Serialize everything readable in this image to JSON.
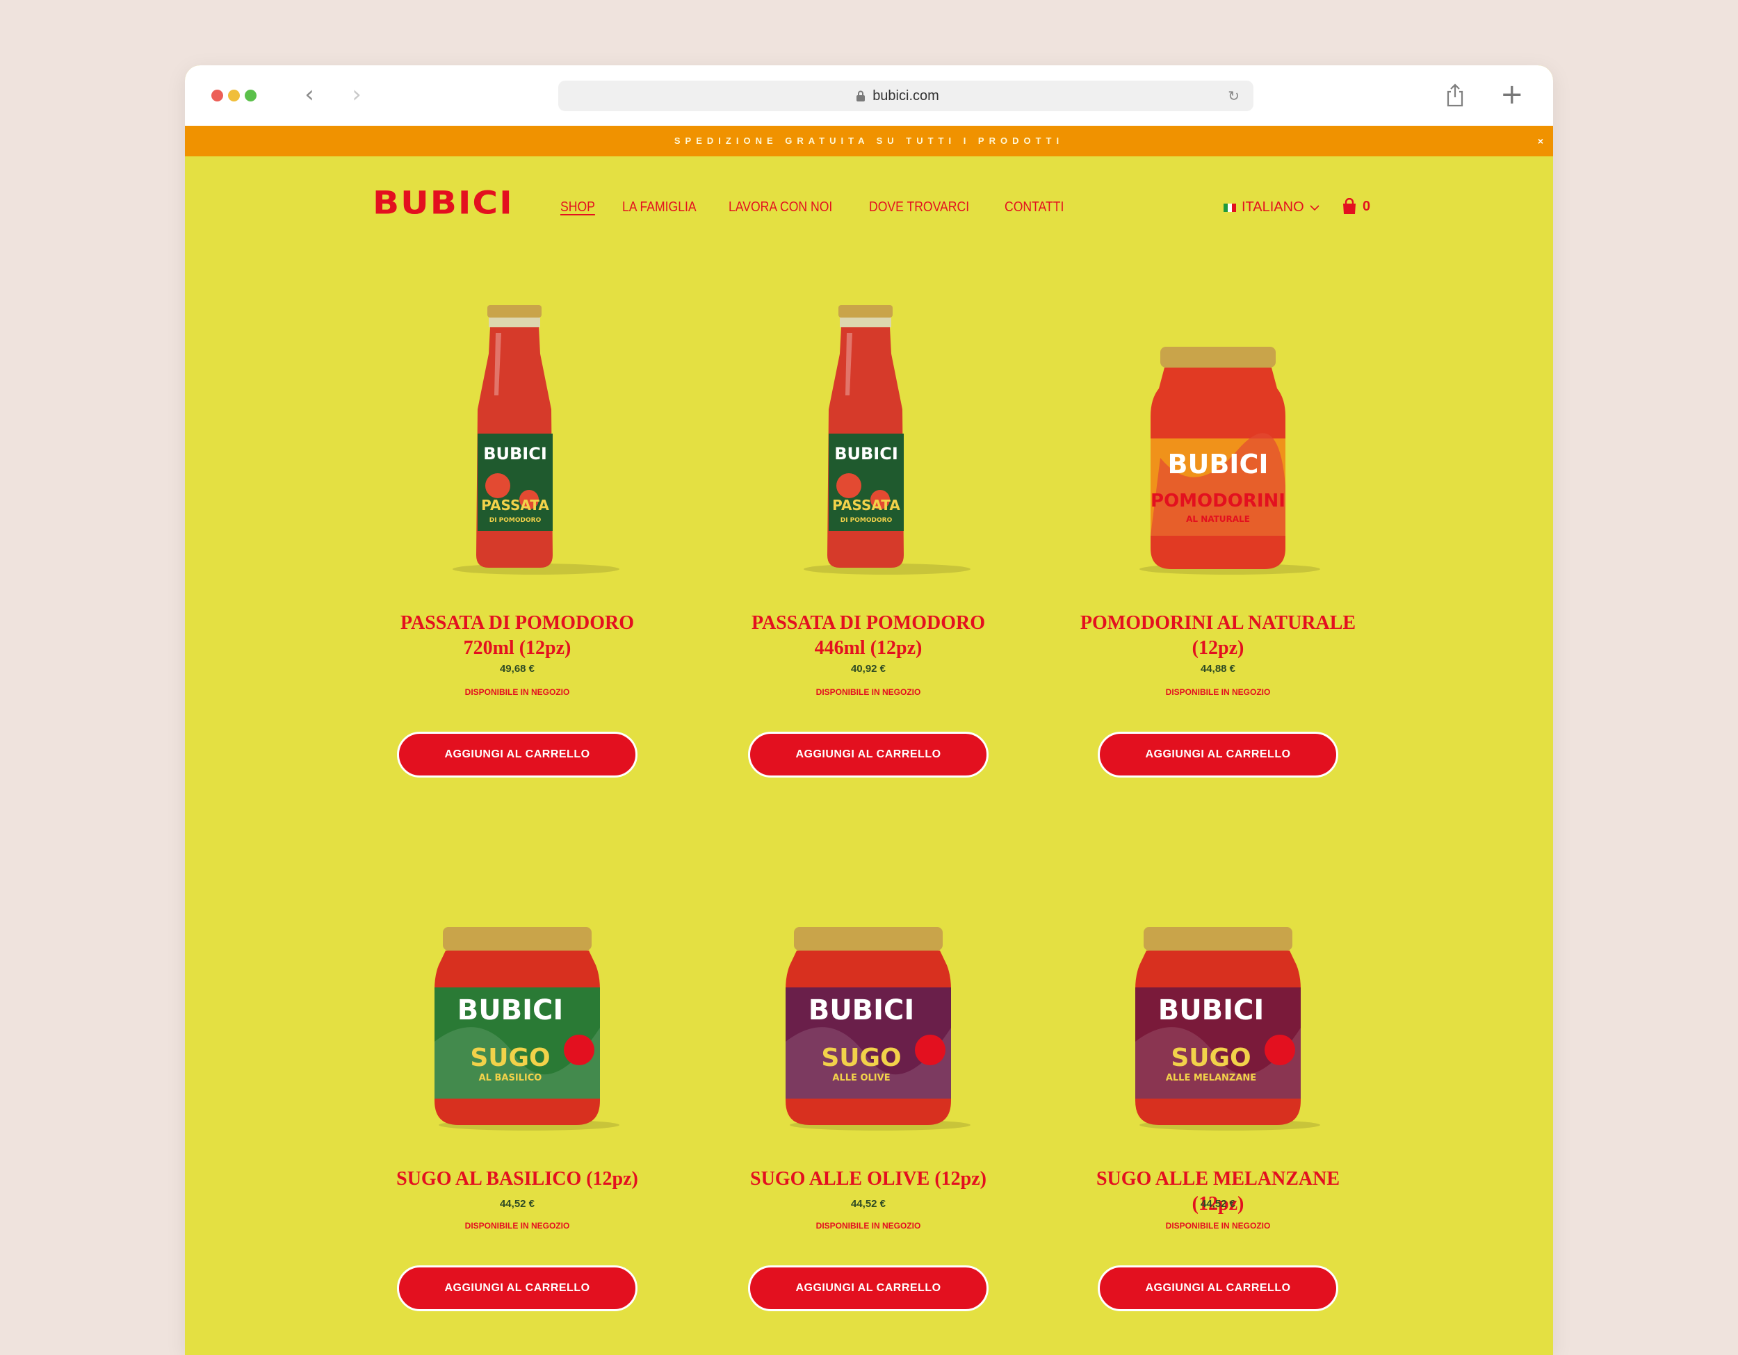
{
  "browser": {
    "url": "bubici.com"
  },
  "banner": {
    "text": "SPEDIZIONE GRATUITA SU TUTTI I PRODOTTI",
    "close": "×"
  },
  "header": {
    "logo": "BUBICI",
    "nav": [
      "SHOP",
      "LA FAMIGLIA",
      "LAVORA CON NOI",
      "DOVE TROVARCI",
      "CONTATTI"
    ],
    "language": "ITALIANO",
    "cart_count": "0"
  },
  "colors": {
    "page_bg": "#e4e042",
    "brand_red": "#e3101f",
    "banner_orange": "#f09200"
  },
  "products": [
    {
      "title_line1": "PASSATA DI POMODORO",
      "title_line2": "720ml (12pz)",
      "price": "49,68 €",
      "availability": "DISPONIBILE IN NEGOZIO",
      "button": "AGGIUNGI AL CARRELLO",
      "jar_type": "bottle",
      "label_name": "PASSATA",
      "label_sub": "DI POMODORO",
      "label_color": "#1f5a2e"
    },
    {
      "title_line1": "PASSATA DI POMODORO",
      "title_line2": "446ml (12pz)",
      "price": "40,92 €",
      "availability": "DISPONIBILE IN NEGOZIO",
      "button": "AGGIUNGI AL CARRELLO",
      "jar_type": "bottle",
      "label_name": "PASSATA",
      "label_sub": "DI POMODORO",
      "label_color": "#1f5a2e"
    },
    {
      "title_line1": "POMODORINI AL NATURALE",
      "title_line2": "(12pz)",
      "price": "44,88 €",
      "availability": "DISPONIBILE IN NEGOZIO",
      "button": "AGGIUNGI AL CARRELLO",
      "jar_type": "tall-jar",
      "label_name": "POMODORINI",
      "label_sub": "AL NATURALE",
      "label_color": "#f0921a"
    },
    {
      "title_line1": "SUGO AL BASILICO (12pz)",
      "title_line2": "",
      "price": "44,52 €",
      "availability": "DISPONIBILE IN NEGOZIO",
      "button": "AGGIUNGI AL CARRELLO",
      "jar_type": "jar",
      "label_name": "SUGO",
      "label_sub": "AL BASILICO",
      "label_color": "#2a7a35"
    },
    {
      "title_line1": "SUGO ALLE OLIVE (12pz)",
      "title_line2": "",
      "price": "44,52 €",
      "availability": "DISPONIBILE IN NEGOZIO",
      "button": "AGGIUNGI AL CARRELLO",
      "jar_type": "jar",
      "label_name": "SUGO",
      "label_sub": "ALLE OLIVE",
      "label_color": "#6a1f4a"
    },
    {
      "title_line1": "SUGO ALLE MELANZANE (12pz)",
      "title_line2": "",
      "price": "44,52 €",
      "availability": "DISPONIBILE IN NEGOZIO",
      "button": "AGGIUNGI AL CARRELLO",
      "jar_type": "jar",
      "label_name": "SUGO",
      "label_sub": "ALLE MELANZANE",
      "label_color": "#7a1a3a"
    }
  ]
}
